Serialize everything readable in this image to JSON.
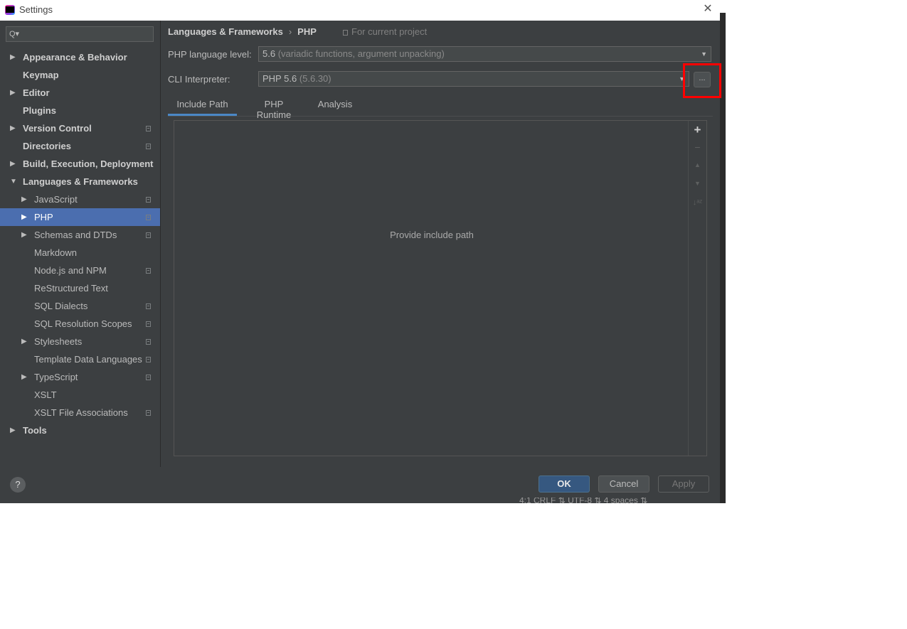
{
  "window": {
    "title": "Settings"
  },
  "search": {
    "value": ""
  },
  "sidebar": {
    "items": [
      {
        "label": "Appearance & Behavior",
        "level": 0,
        "arrow": "▶",
        "bold": true,
        "proj": false,
        "selected": false
      },
      {
        "label": "Keymap",
        "level": 0,
        "arrow": "",
        "bold": true,
        "proj": false,
        "selected": false
      },
      {
        "label": "Editor",
        "level": 0,
        "arrow": "▶",
        "bold": true,
        "proj": false,
        "selected": false
      },
      {
        "label": "Plugins",
        "level": 0,
        "arrow": "",
        "bold": true,
        "proj": false,
        "selected": false
      },
      {
        "label": "Version Control",
        "level": 0,
        "arrow": "▶",
        "bold": true,
        "proj": true,
        "selected": false
      },
      {
        "label": "Directories",
        "level": 0,
        "arrow": "",
        "bold": true,
        "proj": true,
        "selected": false
      },
      {
        "label": "Build, Execution, Deployment",
        "level": 0,
        "arrow": "▶",
        "bold": true,
        "proj": false,
        "selected": false
      },
      {
        "label": "Languages & Frameworks",
        "level": 0,
        "arrow": "▼",
        "bold": true,
        "proj": false,
        "selected": false
      },
      {
        "label": "JavaScript",
        "level": 1,
        "arrow": "▶",
        "bold": false,
        "proj": true,
        "selected": false
      },
      {
        "label": "PHP",
        "level": 1,
        "arrow": "▶",
        "bold": false,
        "proj": true,
        "selected": true
      },
      {
        "label": "Schemas and DTDs",
        "level": 1,
        "arrow": "▶",
        "bold": false,
        "proj": true,
        "selected": false
      },
      {
        "label": "Markdown",
        "level": 1,
        "arrow": "",
        "bold": false,
        "proj": false,
        "selected": false
      },
      {
        "label": "Node.js and NPM",
        "level": 1,
        "arrow": "",
        "bold": false,
        "proj": true,
        "selected": false
      },
      {
        "label": "ReStructured Text",
        "level": 1,
        "arrow": "",
        "bold": false,
        "proj": false,
        "selected": false
      },
      {
        "label": "SQL Dialects",
        "level": 1,
        "arrow": "",
        "bold": false,
        "proj": true,
        "selected": false
      },
      {
        "label": "SQL Resolution Scopes",
        "level": 1,
        "arrow": "",
        "bold": false,
        "proj": true,
        "selected": false
      },
      {
        "label": "Stylesheets",
        "level": 1,
        "arrow": "▶",
        "bold": false,
        "proj": true,
        "selected": false
      },
      {
        "label": "Template Data Languages",
        "level": 1,
        "arrow": "",
        "bold": false,
        "proj": true,
        "selected": false
      },
      {
        "label": "TypeScript",
        "level": 1,
        "arrow": "▶",
        "bold": false,
        "proj": true,
        "selected": false
      },
      {
        "label": "XSLT",
        "level": 1,
        "arrow": "",
        "bold": false,
        "proj": false,
        "selected": false
      },
      {
        "label": "XSLT File Associations",
        "level": 1,
        "arrow": "",
        "bold": false,
        "proj": true,
        "selected": false
      },
      {
        "label": "Tools",
        "level": 0,
        "arrow": "▶",
        "bold": true,
        "proj": false,
        "selected": false
      }
    ]
  },
  "breadcrumb": {
    "parent": "Languages & Frameworks",
    "separator": "›",
    "current": "PHP"
  },
  "scope_label": "For current project",
  "php_level": {
    "label": "PHP language level:",
    "value": "5.6",
    "hint": "(variadic functions, argument unpacking)"
  },
  "cli": {
    "label": "CLI Interpreter:",
    "value": "PHP 5.6",
    "hint": "(5.6.30)",
    "browse": "..."
  },
  "tabs": [
    "Include Path",
    "PHP Runtime",
    "Analysis"
  ],
  "include_path": {
    "empty_text": "Provide include path"
  },
  "icons": {
    "add": "+",
    "remove": "−",
    "up": "▲",
    "down": "▼",
    "sort": "↓ᵃᶻ",
    "help": "?",
    "close": "✕"
  },
  "buttons": {
    "ok": "OK",
    "cancel": "Cancel",
    "apply": "Apply"
  },
  "status_bar": "4:1   CRLF ⇅   UTF-8 ⇅   4 spaces ⇅"
}
